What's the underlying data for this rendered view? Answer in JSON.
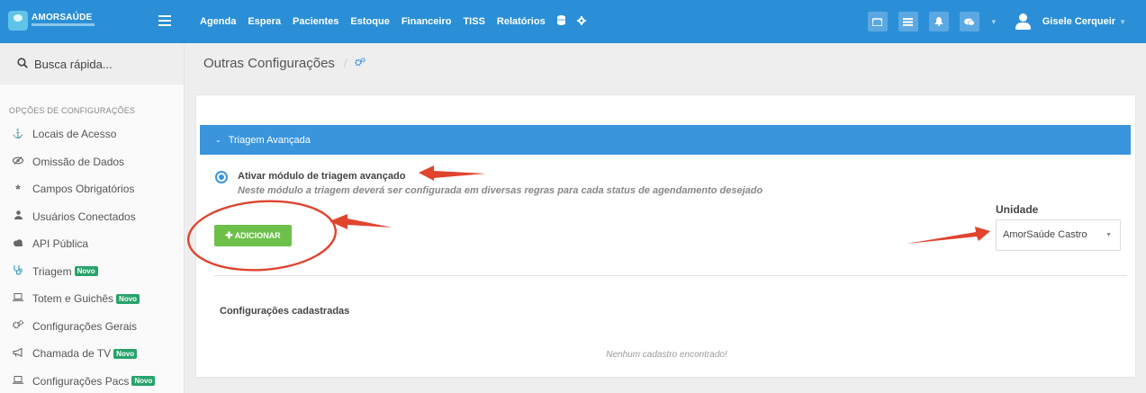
{
  "brand": {
    "name": "AMORSAÚDE"
  },
  "topnav": {
    "items": [
      "Agenda",
      "Espera",
      "Pacientes",
      "Estoque",
      "Financeiro",
      "TISS",
      "Relatórios"
    ],
    "icons": [
      "database-icon",
      "gear-icon"
    ]
  },
  "topright": {
    "buttons": [
      "inbox-icon",
      "list-icon",
      "bell-icon",
      "chat-icon"
    ],
    "user_name": "Gisele Cerqueir"
  },
  "sidebar": {
    "search_placeholder": "Busca rápida...",
    "header": "OPÇÕES DE CONFIGURAÇÕES",
    "items": [
      {
        "label": "Locais de Acesso",
        "icon": "anchor-icon",
        "badge": ""
      },
      {
        "label": "Omissão de Dados",
        "icon": "eye-slash-icon",
        "badge": ""
      },
      {
        "label": "Campos Obrigatórios",
        "icon": "asterisk-icon",
        "badge": ""
      },
      {
        "label": "Usuários Conectados",
        "icon": "user-icon",
        "badge": ""
      },
      {
        "label": "API Pública",
        "icon": "cloud-icon",
        "badge": ""
      },
      {
        "label": "Triagem",
        "icon": "stethoscope-icon",
        "badge": "Novo"
      },
      {
        "label": "Totem e Guichês",
        "icon": "laptop-icon",
        "badge": "Novo"
      },
      {
        "label": "Configurações Gerais",
        "icon": "gears-icon",
        "badge": ""
      },
      {
        "label": "Chamada de TV",
        "icon": "bullhorn-icon",
        "badge": "Novo"
      },
      {
        "label": "Configurações Pacs",
        "icon": "laptop-icon",
        "badge": "Novo"
      }
    ]
  },
  "page": {
    "title": "Outras Configurações",
    "section_title": "Triagem Avançada",
    "radio_label": "Ativar módulo de triagem avançado",
    "radio_help": "Neste módulo a triagem deverá ser configurada em diversas regras para cada status de agendamento desejado",
    "add_button": "ADICIONAR",
    "unit_label": "Unidade",
    "unit_value": "AmorSaúde Castro",
    "configs_title": "Configurações cadastradas",
    "empty_message": "Nenhum cadastro encontrado!"
  },
  "colors": {
    "primary": "#2a8fd6",
    "accordion": "#3a95dd",
    "success": "#6cc04a",
    "badge": "#27a36a",
    "annotation": "#e0442e"
  }
}
